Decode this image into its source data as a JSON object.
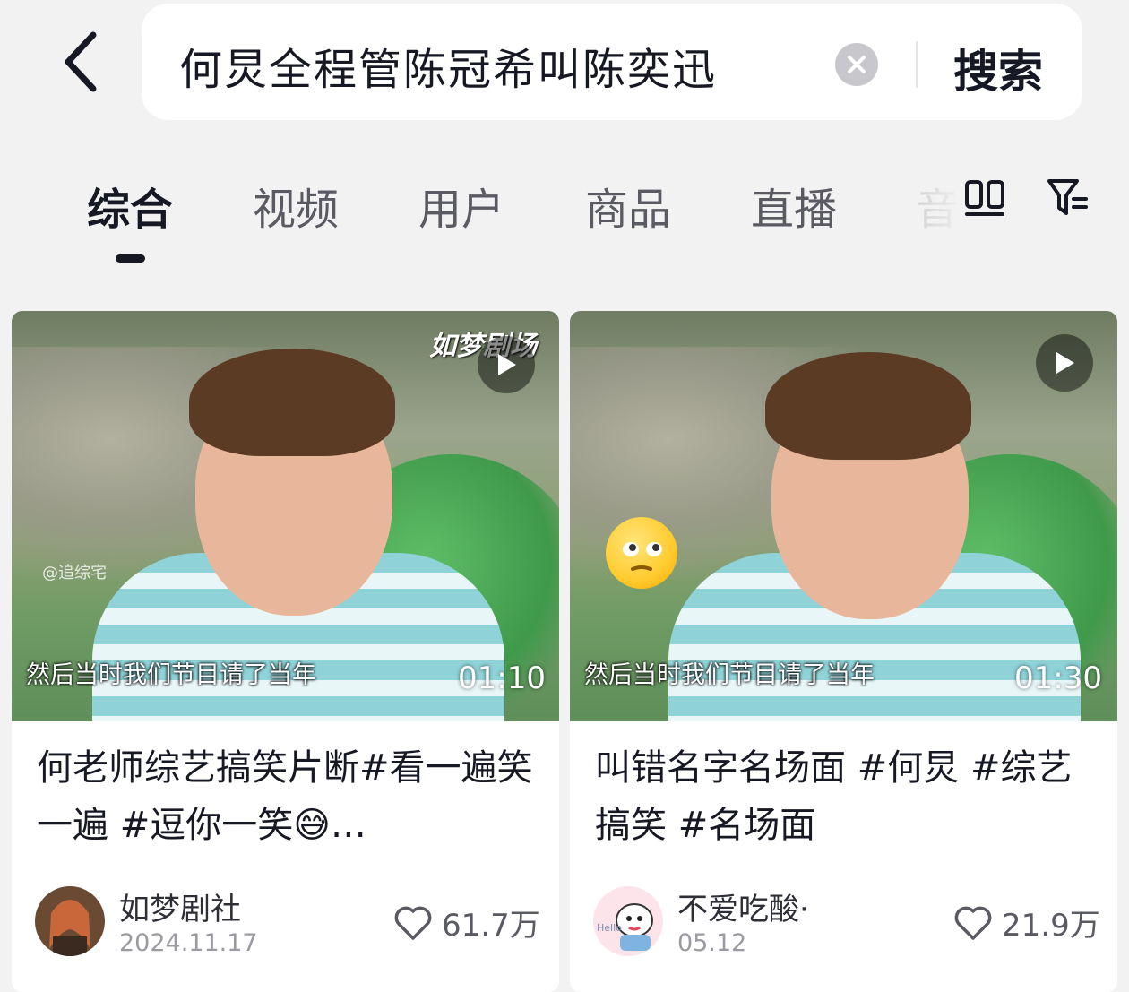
{
  "header": {
    "search_query": "何炅全程管陈冠希叫陈奕迅",
    "search_button": "搜索"
  },
  "tabs": [
    {
      "label": "综合"
    },
    {
      "label": "视频"
    },
    {
      "label": "用户"
    },
    {
      "label": "商品"
    },
    {
      "label": "直播"
    },
    {
      "label": "音"
    }
  ],
  "results": [
    {
      "watermark": "如梦剧场",
      "source_mark": "@追综宅",
      "subtitle": "然后当时我们节目请了当年",
      "duration": "01:10",
      "title": "何老师综艺搞笑片断#看一遍笑一遍 #逗你一笑😅…",
      "author": "如梦剧社",
      "date": "2024.11.17",
      "likes": "61.7万"
    },
    {
      "subtitle": "然后当时我们节目请了当年",
      "duration": "01:30",
      "title": "叫错名字名场面 #何炅 #综艺搞笑 #名场面",
      "author": "不爱吃酸·",
      "date": "05.12",
      "likes": "21.9万"
    }
  ]
}
